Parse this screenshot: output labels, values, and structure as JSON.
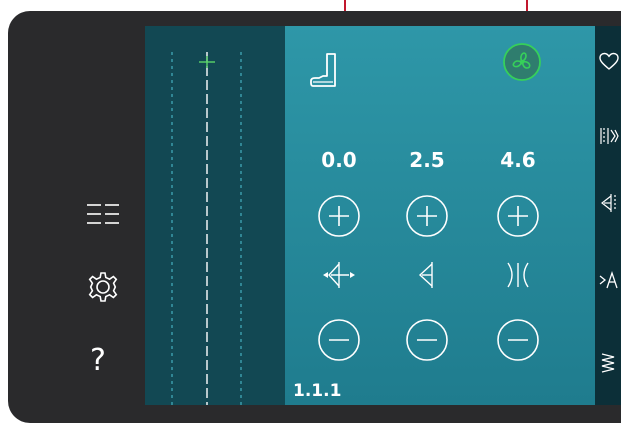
{
  "values": {
    "left": "0.0",
    "center": "2.5",
    "right": "4.6"
  },
  "stitch_code": "1.1.1",
  "help_symbol": "?",
  "colors": {
    "callout_line": "#c2182e",
    "frame": "#2a2a2c",
    "panel_top": "#2e97a8",
    "panel_bottom": "#1f7c8e",
    "preview_bg": "#124853",
    "sew_start_green": "#36d05a",
    "needle_marker_green": "#5bd56a"
  },
  "icons": {
    "presser_foot": "presser-foot-icon",
    "speed": "sew-speed-icon",
    "menu": "menu-list-icon",
    "settings": "gear-icon",
    "help": "question-icon",
    "right_rail": [
      "heart-icon",
      "stitch-repeat-icon",
      "mirror-side-icon",
      "alphabet-icon",
      "zigzag-icon"
    ]
  }
}
